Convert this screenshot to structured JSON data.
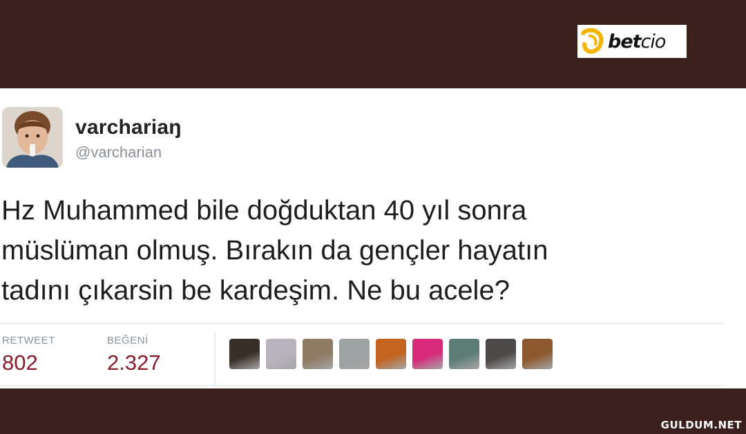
{
  "logo": {
    "bold": "bet",
    "light": "cio",
    "accent": "#f5b400"
  },
  "tweet": {
    "display_name": "varchariaŋ",
    "handle": "@varcharian",
    "lines": [
      "Hz Muhammed bile doğduktan 40 yıl sonra",
      "müslüman olmuş. Bırakın da gençler hayatın",
      "tadını çıkarsin be kardeşim. Ne bu acele?"
    ],
    "stats": {
      "retweet_label": "RETWEET",
      "retweet_count": "802",
      "likes_label": "BEĞENİ",
      "likes_count": "2.327"
    },
    "liker_colors": [
      "#3a2f28",
      "#b9b3bf",
      "#8f7a63",
      "#9da2a3",
      "#c2631f",
      "#d62b7a",
      "#5d7c76",
      "#4d4948",
      "#8c5a2e"
    ],
    "count_color": "#8b1a2a"
  },
  "watermark": "GULDUM.NET"
}
